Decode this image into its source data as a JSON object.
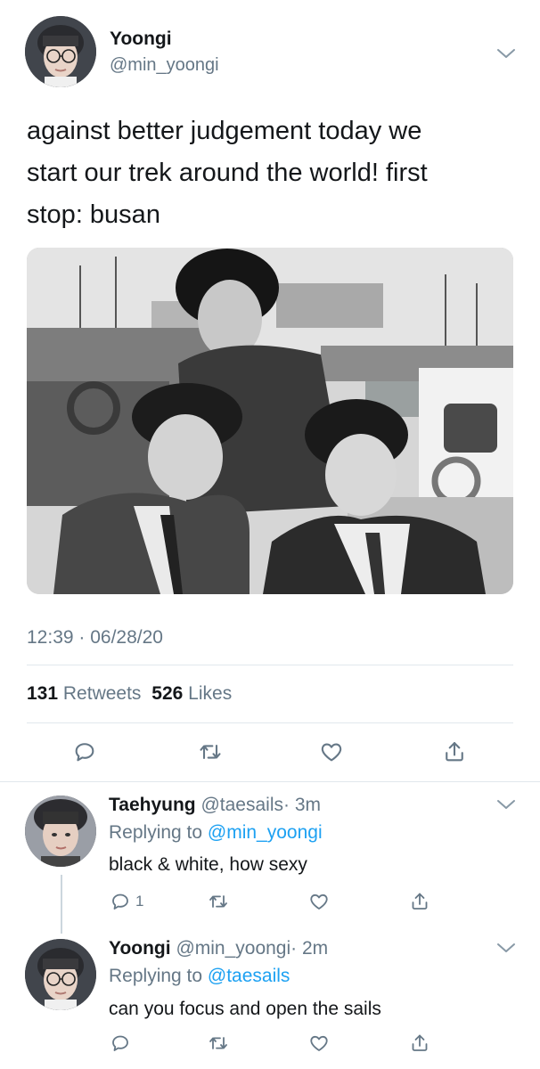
{
  "main_tweet": {
    "display_name": "Yoongi",
    "handle": "@min_yoongi",
    "text_lines": [
      "against better judgement today we",
      "start our trek around the world! first",
      "stop: busan"
    ],
    "timestamp": "12:39 · 06/28/20",
    "retweets_count": "131",
    "retweets_label": "Retweets",
    "likes_count": "526",
    "likes_label": "Likes"
  },
  "replies": [
    {
      "display_name": "Taehyung",
      "handle": "@taesails",
      "time": "· 3m",
      "replying_prefix": "Replying to",
      "replying_to": "@min_yoongi",
      "text": "black & white, how sexy",
      "reply_count": "1"
    },
    {
      "display_name": "Yoongi",
      "handle": "@min_yoongi",
      "time": "· 2m",
      "replying_prefix": "Replying to",
      "replying_to": "@taesails",
      "text": "can you focus and open the sails"
    }
  ],
  "icons": {
    "reply": "comment-icon",
    "retweet": "retweet-icon",
    "like": "heart-icon",
    "share": "share-icon",
    "menu": "chevron-down-icon"
  },
  "colors": {
    "text": "#14171a",
    "muted": "#657786",
    "link": "#1da1f2",
    "divider": "#e1e8ed"
  }
}
